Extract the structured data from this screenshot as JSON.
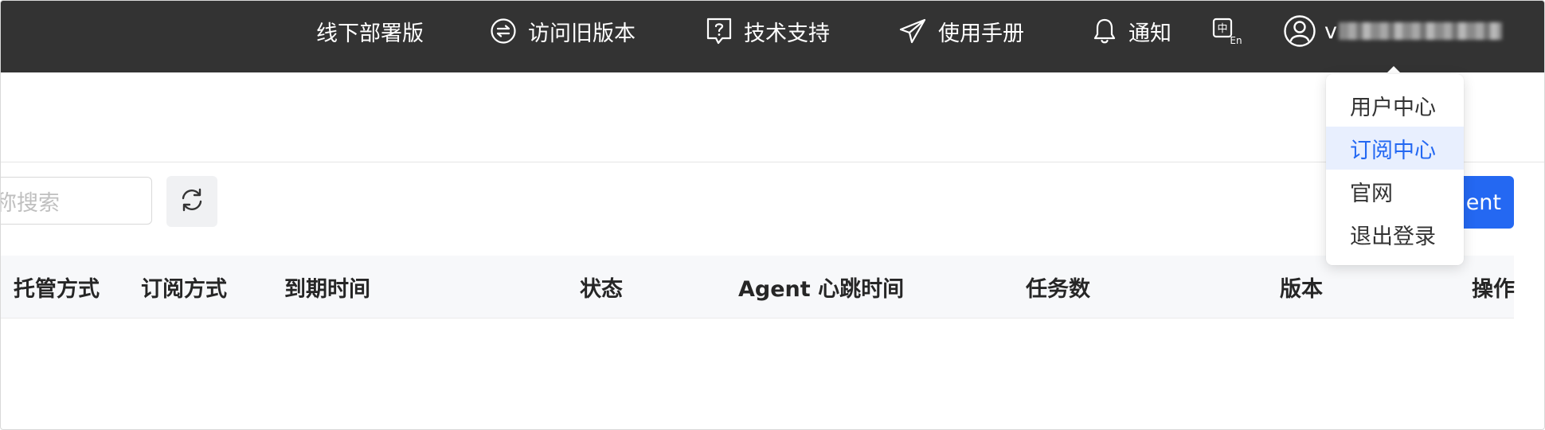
{
  "topbar": {
    "items": [
      {
        "label": "线下部署版"
      },
      {
        "label": "访问旧版本"
      },
      {
        "label": "技术支持"
      },
      {
        "label": "使用手册"
      },
      {
        "label": "通知"
      }
    ],
    "user": {
      "initial": "v"
    },
    "language_icon": "language-switch-icon"
  },
  "toolbar": {
    "search_placeholder": "称搜索",
    "primary_button_label": "ent"
  },
  "table": {
    "columns": [
      "托管方式",
      "订阅方式",
      "到期时间",
      "状态",
      "Agent 心跳时间",
      "任务数",
      "版本",
      "操作"
    ]
  },
  "user_menu": {
    "items": [
      {
        "label": "用户中心"
      },
      {
        "label": "订阅中心"
      },
      {
        "label": "官网"
      },
      {
        "label": "退出登录"
      }
    ]
  },
  "colors": {
    "topbar_bg": "#333333",
    "accent": "#2468f2",
    "menu_active_bg": "#e8effe"
  }
}
